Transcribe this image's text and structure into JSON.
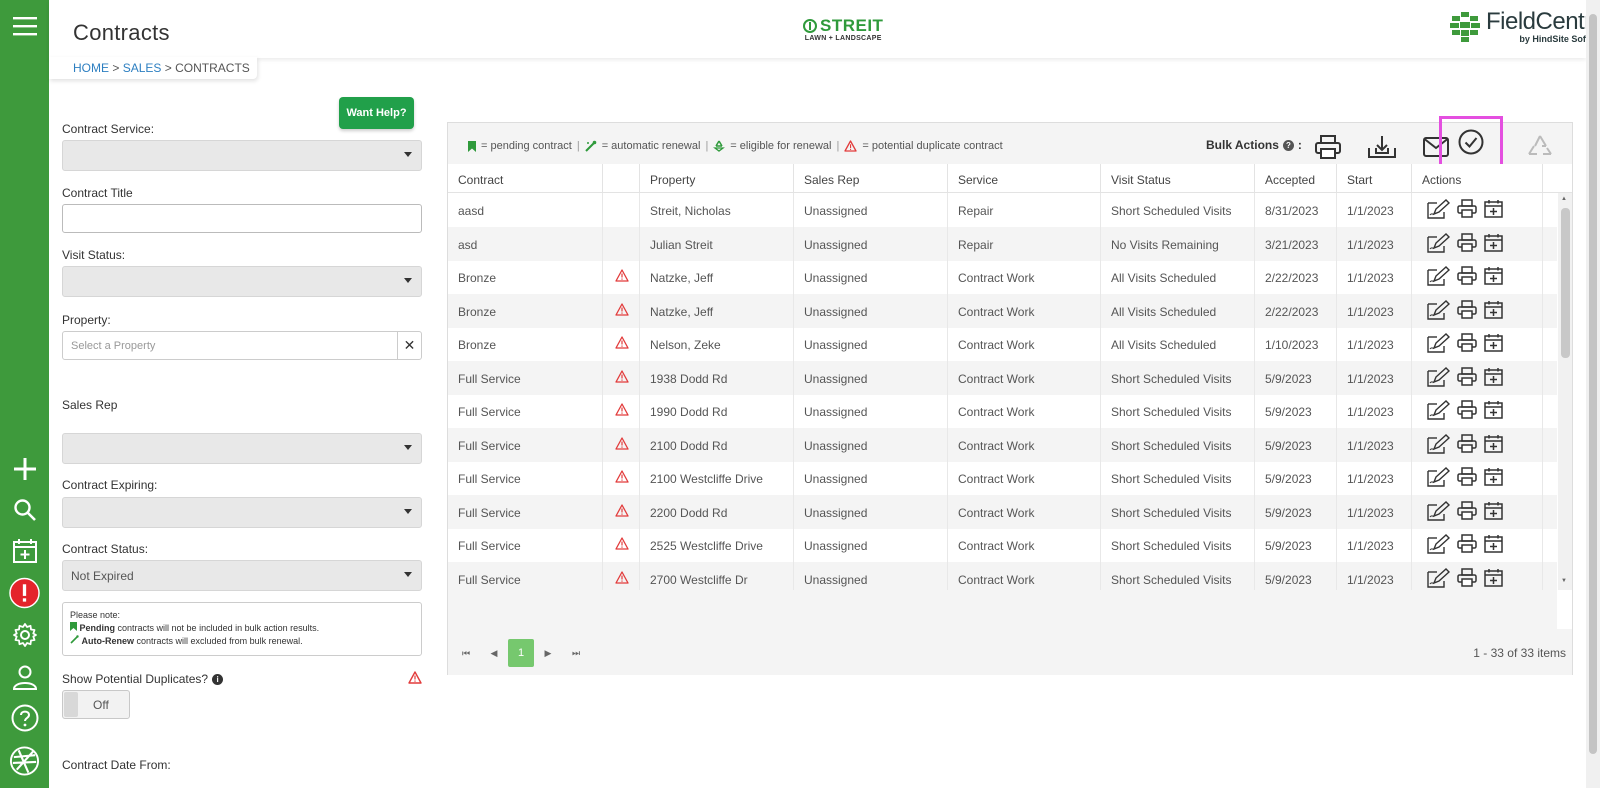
{
  "page": {
    "title": "Contracts",
    "breadcrumb": {
      "home": "HOME",
      "sales": "SALES",
      "current": "CONTRACTS",
      "sep": ">"
    }
  },
  "brand": {
    "company_big": "STREIT",
    "company_small": "LAWN + LANDSCAPE",
    "product_name": "FieldCentral",
    "product_by": "by HindSite Software",
    "green": "#3e9a3c",
    "highlight": "#e44fe0"
  },
  "rail": {
    "icons": [
      "menu-icon",
      "add-icon",
      "search-icon",
      "calendar-add-icon",
      "alert-icon",
      "gear-icon",
      "user-icon",
      "help-icon",
      "fieldcentral-logo-icon"
    ]
  },
  "filters": {
    "help_button": "Want Help?",
    "contract_service_label": "Contract Service:",
    "contract_service_value": "",
    "contract_title_label": "Contract Title",
    "visit_status_label": "Visit Status:",
    "visit_status_value": "",
    "property_label": "Property:",
    "property_placeholder": "Select a Property",
    "property_clear": "✕",
    "sales_rep_label": "Sales Rep",
    "sales_rep_value": "",
    "contract_expiring_label": "Contract Expiring:",
    "contract_expiring_value": "",
    "contract_status_label": "Contract Status:",
    "contract_status_value": "Not Expired",
    "note_title": "Please note:",
    "note_pending_bold": "Pending",
    "note_pending_text": "contracts will not be included in bulk action results.",
    "note_autorenew_bold": "Auto-Renew",
    "note_autorenew_text": "contracts will excluded from bulk renewal.",
    "show_duplicates_label": "Show Potential Duplicates?",
    "show_duplicates_toggle": "Off",
    "contract_date_from_label": "Contract Date From:"
  },
  "toolbar": {
    "legend": {
      "pending": "= pending contract",
      "auto_renew": "= automatic renewal",
      "eligible": "= eligible for renewal",
      "duplicate": "= potential duplicate contract",
      "sep": "|"
    },
    "bulk_actions_label": "Bulk Actions",
    "bulk_actions_suffix": ":",
    "bulk_buttons": [
      "print-icon",
      "download-icon",
      "email-icon",
      "check-circle-icon",
      "renew-icon"
    ]
  },
  "table": {
    "columns": [
      "Contract",
      "",
      "Property",
      "Sales Rep",
      "Service",
      "Visit Status",
      "Accepted",
      "Start",
      "Actions"
    ],
    "rows": [
      {
        "contract": "aasd",
        "dup": false,
        "property": "Streit, Nicholas",
        "rep": "Unassigned",
        "service": "Repair",
        "status": "Short Scheduled Visits",
        "accepted": "8/31/2023",
        "start": "1/1/2023"
      },
      {
        "contract": "asd",
        "dup": false,
        "property": "Julian Streit",
        "rep": "Unassigned",
        "service": "Repair",
        "status": "No Visits Remaining",
        "accepted": "3/21/2023",
        "start": "1/1/2023"
      },
      {
        "contract": "Bronze",
        "dup": true,
        "property": "Natzke, Jeff",
        "rep": "Unassigned",
        "service": "Contract Work",
        "status": "All Visits Scheduled",
        "accepted": "2/22/2023",
        "start": "1/1/2023"
      },
      {
        "contract": "Bronze",
        "dup": true,
        "property": "Natzke, Jeff",
        "rep": "Unassigned",
        "service": "Contract Work",
        "status": "All Visits Scheduled",
        "accepted": "2/22/2023",
        "start": "1/1/2023"
      },
      {
        "contract": "Bronze",
        "dup": true,
        "property": "Nelson, Zeke",
        "rep": "Unassigned",
        "service": "Contract Work",
        "status": "All Visits Scheduled",
        "accepted": "1/10/2023",
        "start": "1/1/2023"
      },
      {
        "contract": "Full Service",
        "dup": true,
        "property": "1938 Dodd Rd",
        "rep": "Unassigned",
        "service": "Contract Work",
        "status": "Short Scheduled Visits",
        "accepted": "5/9/2023",
        "start": "1/1/2023"
      },
      {
        "contract": "Full Service",
        "dup": true,
        "property": "1990 Dodd Rd",
        "rep": "Unassigned",
        "service": "Contract Work",
        "status": "Short Scheduled Visits",
        "accepted": "5/9/2023",
        "start": "1/1/2023"
      },
      {
        "contract": "Full Service",
        "dup": true,
        "property": "2100 Dodd Rd",
        "rep": "Unassigned",
        "service": "Contract Work",
        "status": "Short Scheduled Visits",
        "accepted": "5/9/2023",
        "start": "1/1/2023"
      },
      {
        "contract": "Full Service",
        "dup": true,
        "property": "2100 Westcliffe Drive",
        "rep": "Unassigned",
        "service": "Contract Work",
        "status": "Short Scheduled Visits",
        "accepted": "5/9/2023",
        "start": "1/1/2023"
      },
      {
        "contract": "Full Service",
        "dup": true,
        "property": "2200 Dodd Rd",
        "rep": "Unassigned",
        "service": "Contract Work",
        "status": "Short Scheduled Visits",
        "accepted": "5/9/2023",
        "start": "1/1/2023"
      },
      {
        "contract": "Full Service",
        "dup": true,
        "property": "2525 Westcliffe Drive",
        "rep": "Unassigned",
        "service": "Contract Work",
        "status": "Short Scheduled Visits",
        "accepted": "5/9/2023",
        "start": "1/1/2023"
      },
      {
        "contract": "Full Service",
        "dup": true,
        "property": "2700 Westcliffe Dr",
        "rep": "Unassigned",
        "service": "Contract Work",
        "status": "Short Scheduled Visits",
        "accepted": "5/9/2023",
        "start": "1/1/2023"
      }
    ],
    "row_actions": [
      "edit-icon",
      "print-icon",
      "calendar-add-icon"
    ]
  },
  "pager": {
    "first": "⏮",
    "prev": "◀",
    "current": "1",
    "next": "▶",
    "last": "⏭",
    "count": "1 - 33 of 33 items"
  }
}
